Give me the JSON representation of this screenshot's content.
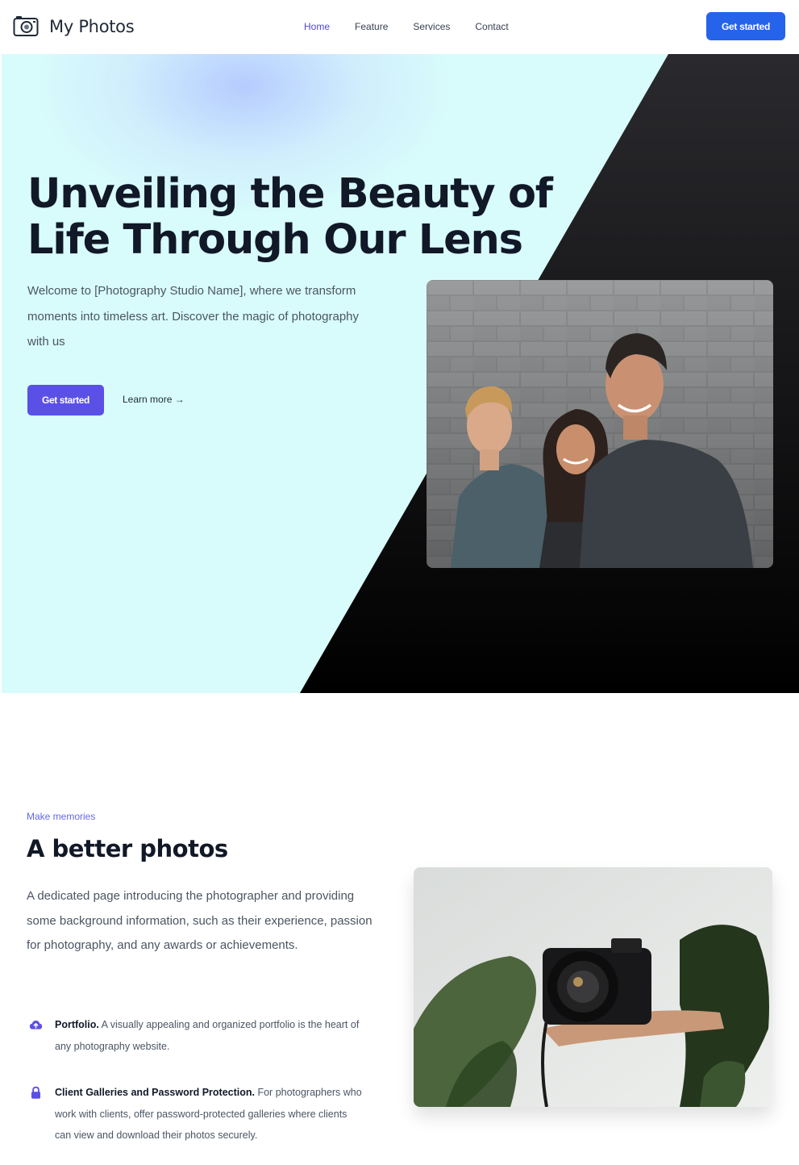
{
  "nav": {
    "brand": "My Photos",
    "brand_icon": "camera-icon",
    "links": [
      {
        "label": "Home",
        "active": true
      },
      {
        "label": "Feature",
        "active": false
      },
      {
        "label": "Services",
        "active": false
      },
      {
        "label": "Contact",
        "active": false
      }
    ],
    "cta": "Get started"
  },
  "hero": {
    "title": "Unveiling the Beauty of Life Through Our Lens",
    "subtitle": "Welcome to [Photography Studio Name], where we transform moments into timeless art. Discover the magic of photography with us",
    "primary_button": "Get started",
    "secondary_link": "Learn more →"
  },
  "about": {
    "eyebrow": "Make memories",
    "title": "A better photos",
    "description": "A dedicated page introducing the photographer and providing some background information, such as their experience, passion for photography, and any awards or achievements.",
    "features": [
      {
        "icon": "cloud-upload-icon",
        "name": "Portfolio.",
        "text": " A visually appealing and organized portfolio is the heart of any photography website."
      },
      {
        "icon": "lock-icon",
        "name": "Client Galleries and Password Protection.",
        "text": " For photographers who work with clients, offer password-protected galleries where clients can view and download their photos securely."
      }
    ]
  },
  "colors": {
    "primary_blue": "#2563eb",
    "indigo": "#5b50e6",
    "hero_bg": "#d8fcfb",
    "dark": "#141416"
  }
}
